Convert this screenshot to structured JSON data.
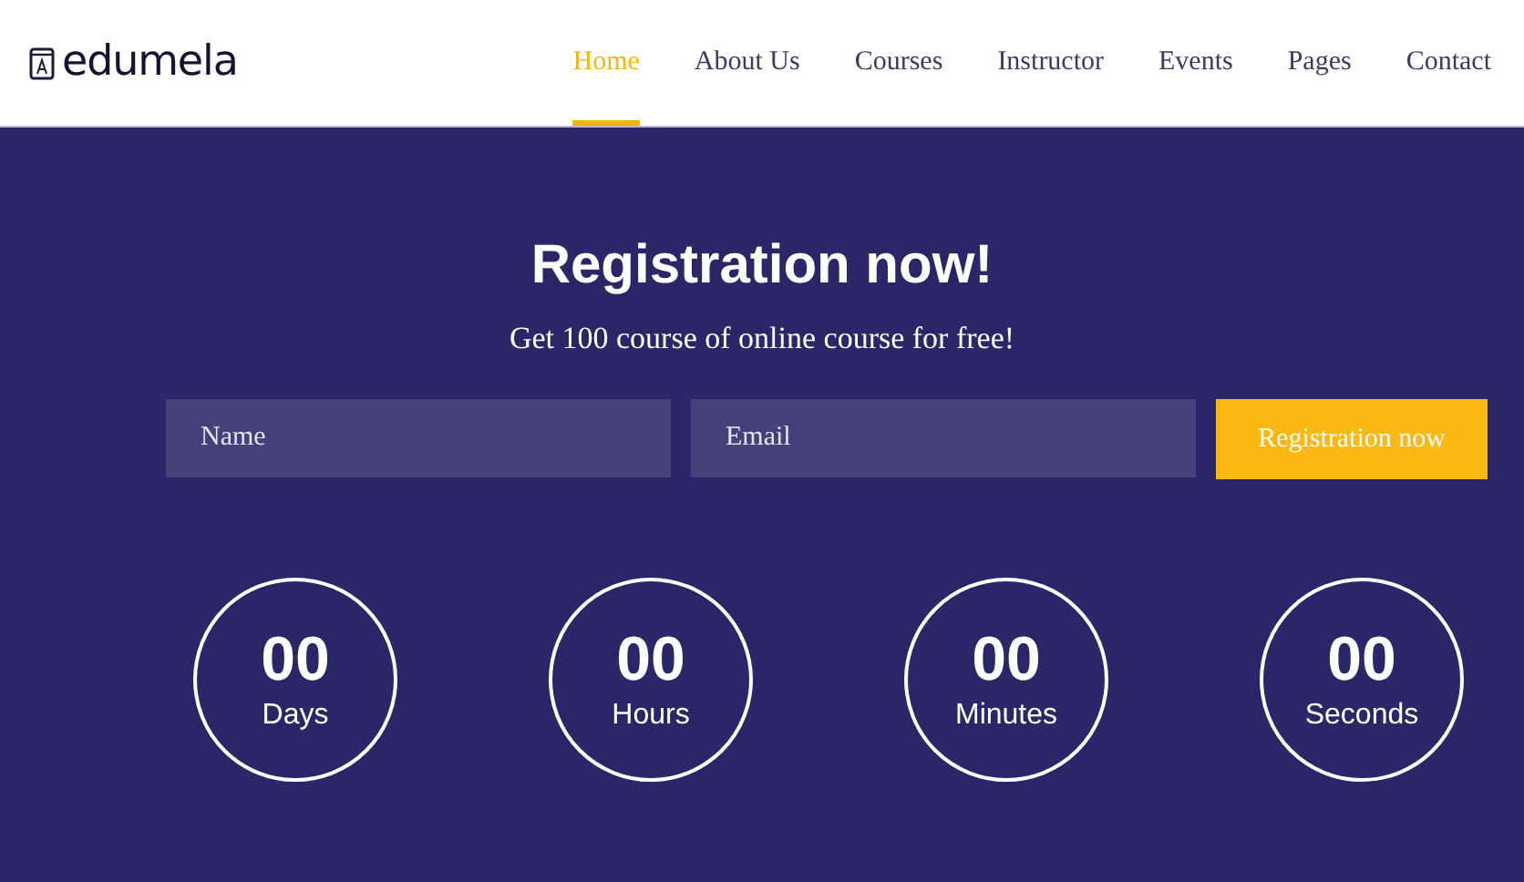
{
  "logo": {
    "text": "edumela"
  },
  "nav": [
    {
      "label": "Home",
      "selected": true
    },
    {
      "label": "About Us",
      "selected": false
    },
    {
      "label": "Courses",
      "selected": false
    },
    {
      "label": "Instructor",
      "selected": false
    },
    {
      "label": "Events",
      "selected": false
    },
    {
      "label": "Pages",
      "selected": false
    },
    {
      "label": "Contact",
      "selected": false
    }
  ],
  "hero": {
    "title": "Registration now!",
    "subtitle": "Get 100 course of online course for free!"
  },
  "form": {
    "fields": [
      {
        "placeholder": "Name"
      },
      {
        "placeholder": "Email"
      }
    ],
    "button": "Registration now"
  },
  "countdown": [
    {
      "value": "00",
      "label": "Days"
    },
    {
      "value": "00",
      "label": "Hours"
    },
    {
      "value": "00",
      "label": "Minutes"
    },
    {
      "value": "00",
      "label": "Seconds"
    }
  ]
}
